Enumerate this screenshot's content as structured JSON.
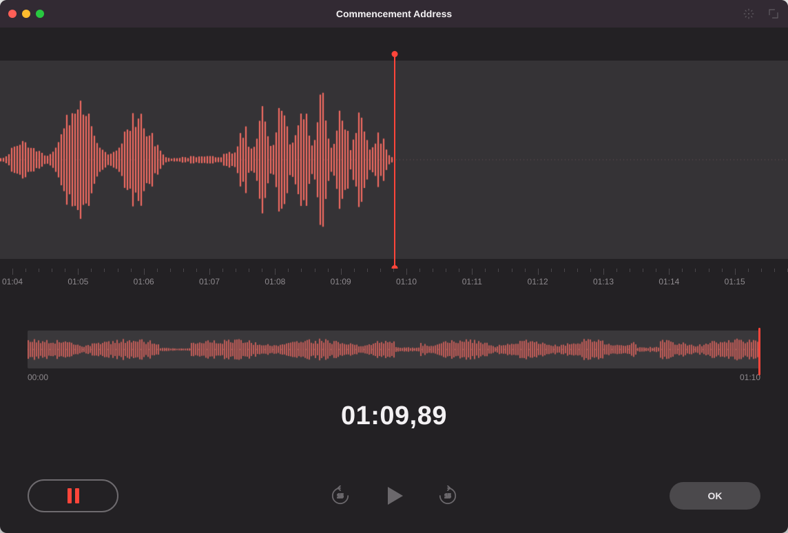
{
  "window": {
    "title": "Commencement Address"
  },
  "ruler": {
    "labels": [
      "01:04",
      "01:05",
      "01:06",
      "01:07",
      "01:08",
      "01:09",
      "01:10",
      "01:11",
      "01:12",
      "01:13",
      "01:14",
      "01:15"
    ]
  },
  "overview": {
    "start": "00:00",
    "end": "01:10"
  },
  "timecode": "01:09,89",
  "buttons": {
    "ok": "OK"
  },
  "skip_seconds": "15",
  "colors": {
    "accent": "#ff453a"
  }
}
